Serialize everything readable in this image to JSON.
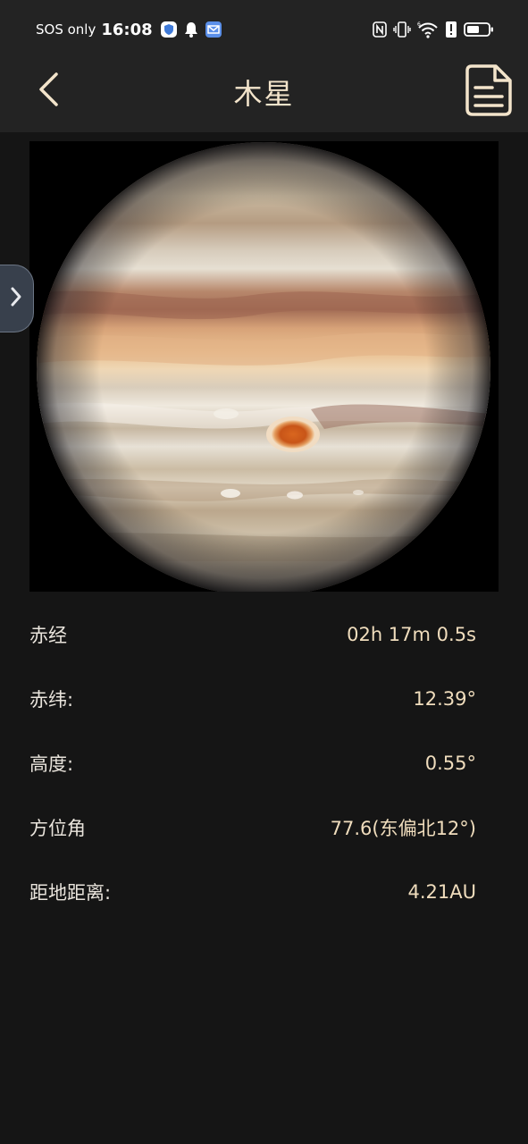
{
  "status_bar": {
    "carrier": "SOS only",
    "time": "16:08",
    "icons": [
      "shield-icon",
      "bell-icon",
      "mail-icon",
      "nfc-icon",
      "vibrate-icon",
      "wifi-icon",
      "alert-icon",
      "battery-icon"
    ],
    "battery_level": 0.6
  },
  "header": {
    "title": "木星",
    "back_icon": "chevron-left-icon",
    "doc_icon": "document-icon",
    "accent_color": "#f3e4cb"
  },
  "side_tab": {
    "icon": "chevron-right-icon"
  },
  "details": [
    {
      "label": "赤经",
      "value": "02h 17m 0.5s"
    },
    {
      "label": "赤纬:",
      "value": "12.39°"
    },
    {
      "label": "高度:",
      "value": "0.55°"
    },
    {
      "label": "方位角",
      "value": "77.6(东偏北12°)"
    },
    {
      "label": "距地距离:",
      "value": "4.21AU"
    }
  ]
}
